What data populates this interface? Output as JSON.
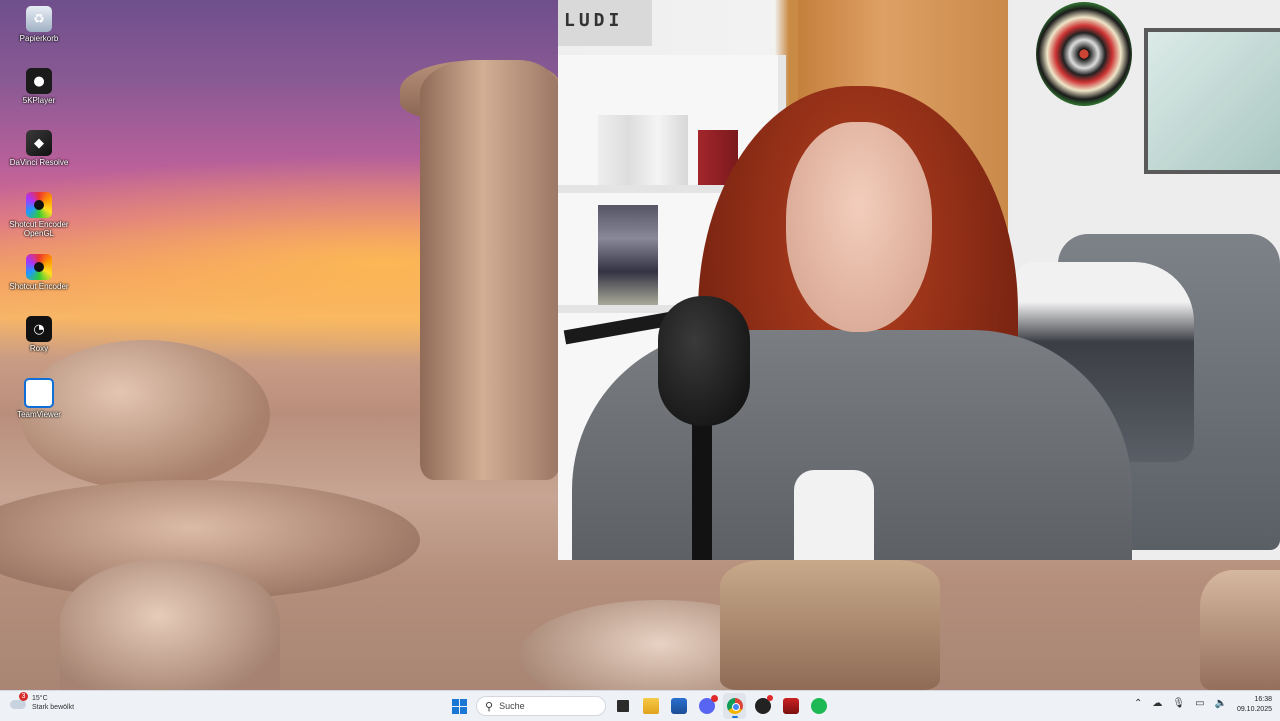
{
  "desktop": {
    "icons": [
      {
        "label": "Papierkorb",
        "icon": "recycle-bin-icon"
      },
      {
        "label": "5KPlayer",
        "icon": "5kplayer-icon"
      },
      {
        "label": "DaVinci Resolve",
        "icon": "davinci-resolve-icon"
      },
      {
        "label": "Shotcut Encoder OpenGL",
        "icon": "shotcut-icon"
      },
      {
        "label": "Shotcut Encoder",
        "icon": "shotcut-icon"
      },
      {
        "label": "Roxy",
        "icon": "roxy-icon"
      },
      {
        "label": "TeamViewer",
        "icon": "teamviewer-icon"
      }
    ]
  },
  "webcam": {
    "sign_text": "LUDI"
  },
  "taskbar": {
    "weather": {
      "temperature": "15°C",
      "condition": "Stark bewölkt",
      "badge": "3"
    },
    "search_placeholder": "Suche",
    "pinned_apps": [
      "task-view-icon",
      "file-explorer-icon",
      "microsoft-store-icon",
      "discord-icon",
      "chrome-icon",
      "obs-icon",
      "davinci-icon",
      "spotify-icon"
    ],
    "tray_icons": [
      "chevron-up-icon",
      "cloud-icon",
      "microphone-icon",
      "monitor-icon",
      "speaker-icon"
    ],
    "clock": {
      "time": "16:38",
      "date": "09.10.2025"
    }
  },
  "colors": {
    "accent": "#1a78d4",
    "taskbar_bg": "#eef1f6"
  }
}
